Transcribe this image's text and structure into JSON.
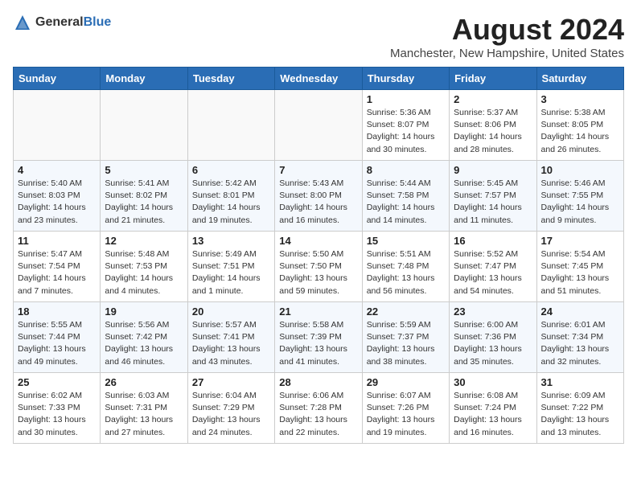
{
  "header": {
    "logo_general": "General",
    "logo_blue": "Blue",
    "month_title": "August 2024",
    "location": "Manchester, New Hampshire, United States"
  },
  "weekdays": [
    "Sunday",
    "Monday",
    "Tuesday",
    "Wednesday",
    "Thursday",
    "Friday",
    "Saturday"
  ],
  "weeks": [
    [
      {
        "day": "",
        "info": ""
      },
      {
        "day": "",
        "info": ""
      },
      {
        "day": "",
        "info": ""
      },
      {
        "day": "",
        "info": ""
      },
      {
        "day": "1",
        "info": "Sunrise: 5:36 AM\nSunset: 8:07 PM\nDaylight: 14 hours\nand 30 minutes."
      },
      {
        "day": "2",
        "info": "Sunrise: 5:37 AM\nSunset: 8:06 PM\nDaylight: 14 hours\nand 28 minutes."
      },
      {
        "day": "3",
        "info": "Sunrise: 5:38 AM\nSunset: 8:05 PM\nDaylight: 14 hours\nand 26 minutes."
      }
    ],
    [
      {
        "day": "4",
        "info": "Sunrise: 5:40 AM\nSunset: 8:03 PM\nDaylight: 14 hours\nand 23 minutes."
      },
      {
        "day": "5",
        "info": "Sunrise: 5:41 AM\nSunset: 8:02 PM\nDaylight: 14 hours\nand 21 minutes."
      },
      {
        "day": "6",
        "info": "Sunrise: 5:42 AM\nSunset: 8:01 PM\nDaylight: 14 hours\nand 19 minutes."
      },
      {
        "day": "7",
        "info": "Sunrise: 5:43 AM\nSunset: 8:00 PM\nDaylight: 14 hours\nand 16 minutes."
      },
      {
        "day": "8",
        "info": "Sunrise: 5:44 AM\nSunset: 7:58 PM\nDaylight: 14 hours\nand 14 minutes."
      },
      {
        "day": "9",
        "info": "Sunrise: 5:45 AM\nSunset: 7:57 PM\nDaylight: 14 hours\nand 11 minutes."
      },
      {
        "day": "10",
        "info": "Sunrise: 5:46 AM\nSunset: 7:55 PM\nDaylight: 14 hours\nand 9 minutes."
      }
    ],
    [
      {
        "day": "11",
        "info": "Sunrise: 5:47 AM\nSunset: 7:54 PM\nDaylight: 14 hours\nand 7 minutes."
      },
      {
        "day": "12",
        "info": "Sunrise: 5:48 AM\nSunset: 7:53 PM\nDaylight: 14 hours\nand 4 minutes."
      },
      {
        "day": "13",
        "info": "Sunrise: 5:49 AM\nSunset: 7:51 PM\nDaylight: 14 hours\nand 1 minute."
      },
      {
        "day": "14",
        "info": "Sunrise: 5:50 AM\nSunset: 7:50 PM\nDaylight: 13 hours\nand 59 minutes."
      },
      {
        "day": "15",
        "info": "Sunrise: 5:51 AM\nSunset: 7:48 PM\nDaylight: 13 hours\nand 56 minutes."
      },
      {
        "day": "16",
        "info": "Sunrise: 5:52 AM\nSunset: 7:47 PM\nDaylight: 13 hours\nand 54 minutes."
      },
      {
        "day": "17",
        "info": "Sunrise: 5:54 AM\nSunset: 7:45 PM\nDaylight: 13 hours\nand 51 minutes."
      }
    ],
    [
      {
        "day": "18",
        "info": "Sunrise: 5:55 AM\nSunset: 7:44 PM\nDaylight: 13 hours\nand 49 minutes."
      },
      {
        "day": "19",
        "info": "Sunrise: 5:56 AM\nSunset: 7:42 PM\nDaylight: 13 hours\nand 46 minutes."
      },
      {
        "day": "20",
        "info": "Sunrise: 5:57 AM\nSunset: 7:41 PM\nDaylight: 13 hours\nand 43 minutes."
      },
      {
        "day": "21",
        "info": "Sunrise: 5:58 AM\nSunset: 7:39 PM\nDaylight: 13 hours\nand 41 minutes."
      },
      {
        "day": "22",
        "info": "Sunrise: 5:59 AM\nSunset: 7:37 PM\nDaylight: 13 hours\nand 38 minutes."
      },
      {
        "day": "23",
        "info": "Sunrise: 6:00 AM\nSunset: 7:36 PM\nDaylight: 13 hours\nand 35 minutes."
      },
      {
        "day": "24",
        "info": "Sunrise: 6:01 AM\nSunset: 7:34 PM\nDaylight: 13 hours\nand 32 minutes."
      }
    ],
    [
      {
        "day": "25",
        "info": "Sunrise: 6:02 AM\nSunset: 7:33 PM\nDaylight: 13 hours\nand 30 minutes."
      },
      {
        "day": "26",
        "info": "Sunrise: 6:03 AM\nSunset: 7:31 PM\nDaylight: 13 hours\nand 27 minutes."
      },
      {
        "day": "27",
        "info": "Sunrise: 6:04 AM\nSunset: 7:29 PM\nDaylight: 13 hours\nand 24 minutes."
      },
      {
        "day": "28",
        "info": "Sunrise: 6:06 AM\nSunset: 7:28 PM\nDaylight: 13 hours\nand 22 minutes."
      },
      {
        "day": "29",
        "info": "Sunrise: 6:07 AM\nSunset: 7:26 PM\nDaylight: 13 hours\nand 19 minutes."
      },
      {
        "day": "30",
        "info": "Sunrise: 6:08 AM\nSunset: 7:24 PM\nDaylight: 13 hours\nand 16 minutes."
      },
      {
        "day": "31",
        "info": "Sunrise: 6:09 AM\nSunset: 7:22 PM\nDaylight: 13 hours\nand 13 minutes."
      }
    ]
  ]
}
